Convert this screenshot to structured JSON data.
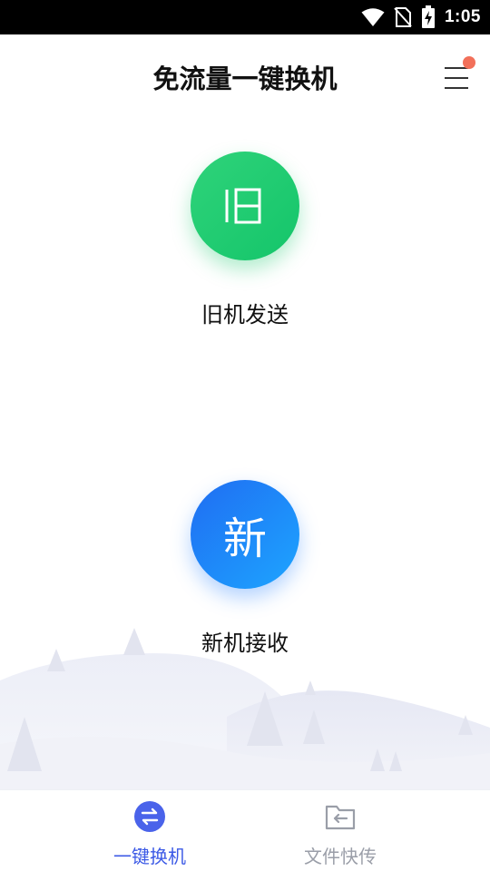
{
  "status_bar": {
    "time": "1:05",
    "icons": [
      "wifi-icon",
      "no-sim-icon",
      "battery-charging-icon"
    ]
  },
  "header": {
    "title": "免流量一键换机",
    "menu_icon": "menu-icon",
    "notification_dot_color": "#f2705a"
  },
  "actions": {
    "old_device": {
      "glyph": "旧",
      "label": "旧机发送",
      "color": "#1fcc70"
    },
    "new_device": {
      "glyph": "新",
      "label": "新机接收",
      "color": "#2185fb"
    }
  },
  "tabs": [
    {
      "label": "一键换机",
      "icon": "swap-arrows-icon",
      "active": true,
      "color": "#3c5ae6"
    },
    {
      "label": "文件快传",
      "icon": "folder-transfer-icon",
      "active": false,
      "color": "#9a9ea8"
    }
  ]
}
